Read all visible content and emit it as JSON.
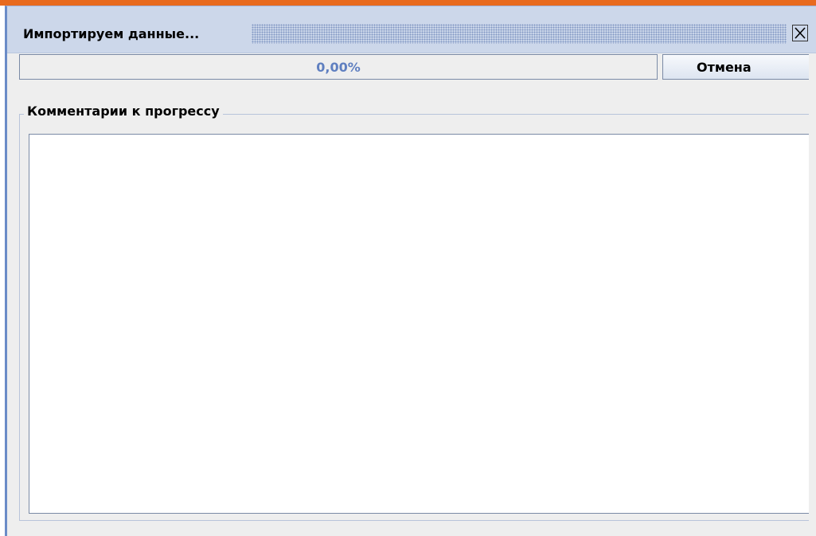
{
  "window": {
    "title": "Импортируем данные..."
  },
  "progress": {
    "label": "0,00%",
    "fraction": 0.0
  },
  "buttons": {
    "cancel_label": "Отмена"
  },
  "comments": {
    "legend": "Комментарии к прогрессу",
    "text": ""
  },
  "icons": {
    "close": "close-icon"
  },
  "colors": {
    "accent_strip": "#e86a1e",
    "titlebar": "#ccd7ea",
    "progress_text": "#5f7fc0"
  }
}
